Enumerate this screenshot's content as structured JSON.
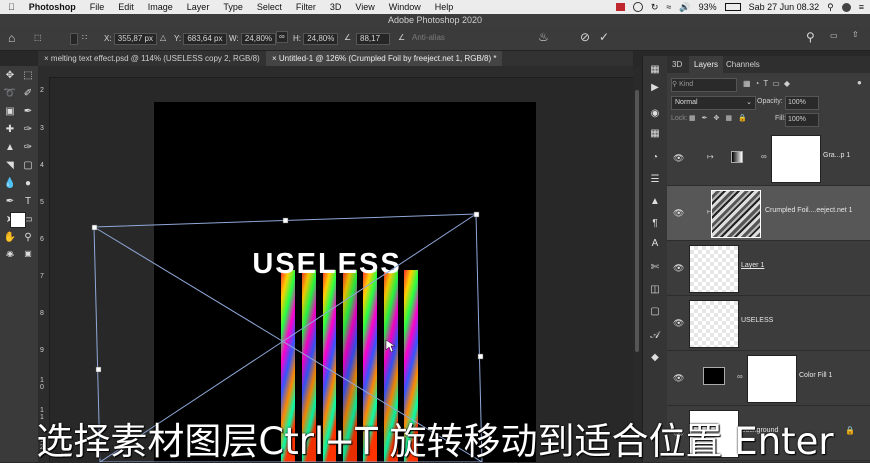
{
  "menubar": {
    "app": "Photoshop",
    "items": [
      "File",
      "Edit",
      "Image",
      "Layer",
      "Type",
      "Select",
      "Filter",
      "3D",
      "View",
      "Window",
      "Help"
    ],
    "battery": "93%",
    "datetime": "Sab 27 Jun  08.32"
  },
  "window_title": "Adobe Photoshop 2020",
  "options": {
    "x_label": "X:",
    "x_value": "355,87 px",
    "y_label": "Y:",
    "y_value": "683,64 px",
    "w_label": "W:",
    "w_value": "24,80%",
    "h_label": "H:",
    "h_value": "24,80%",
    "angle_value": "88,17",
    "antialias": "Anti-alias"
  },
  "doc_tabs": [
    "melting text effect.psd @ 114% (USELESS copy 2, RGB/8)",
    "Untitled-1 @ 126% (Crumpled Foil by freeject.net 1, RGB/8) *"
  ],
  "ruler_left_ticks": [
    "2",
    "3",
    "4",
    "5",
    "6",
    "7",
    "8",
    "9",
    "1\n0",
    "1\n1",
    "1\n2"
  ],
  "canvas": {
    "headline": "USELESS"
  },
  "panel_tabs": {
    "t3d": "3D",
    "layers": "Layers",
    "channels": "Channels"
  },
  "layers_panel": {
    "kind_placeholder": "Kind",
    "blend_mode": "Normal",
    "opacity_label": "Opacity:",
    "opacity_value": "100%",
    "lock_label": "Lock:",
    "fill_label": "Fill:",
    "fill_value": "100%",
    "layers": [
      {
        "name": "Gra...p 1"
      },
      {
        "name": "Crumpled Foil....eeject.net 1"
      },
      {
        "name": "Layer 1"
      },
      {
        "name": "USELESS"
      },
      {
        "name": "Color Fill 1"
      },
      {
        "name": "Background"
      }
    ]
  },
  "subtitle": "选择素材图层Ctrl+T 旋转移动到适合位置 Enter"
}
